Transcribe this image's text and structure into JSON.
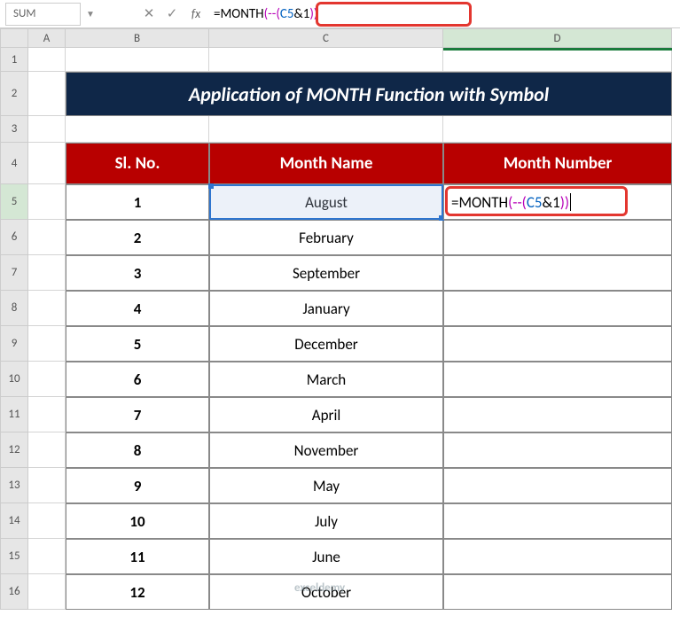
{
  "nameBox": "SUM",
  "formula": {
    "eq": "=",
    "fn": "MONTH",
    "op1": "(--(",
    "ref": "C5",
    "op2": "&",
    "num": "1",
    "op3": "))"
  },
  "colHeads": {
    "A": "A",
    "B": "B",
    "C": "C",
    "D": "D"
  },
  "rowHeads": [
    "1",
    "2",
    "3",
    "4",
    "5",
    "6",
    "7",
    "8",
    "9",
    "10",
    "11",
    "12",
    "13",
    "14",
    "15",
    "16"
  ],
  "title": "Application of MONTH Function with Symbol",
  "headers": {
    "sl": "Sl. No.",
    "month": "Month Name",
    "num": "Month Number"
  },
  "rows": [
    {
      "n": "1",
      "m": "August"
    },
    {
      "n": "2",
      "m": "February"
    },
    {
      "n": "3",
      "m": "September"
    },
    {
      "n": "4",
      "m": "January"
    },
    {
      "n": "5",
      "m": "December"
    },
    {
      "n": "6",
      "m": "March"
    },
    {
      "n": "7",
      "m": "April"
    },
    {
      "n": "8",
      "m": "November"
    },
    {
      "n": "9",
      "m": "May"
    },
    {
      "n": "10",
      "m": "July"
    },
    {
      "n": "11",
      "m": "June"
    },
    {
      "n": "12",
      "m": "October"
    }
  ],
  "watermark": "exceldemy"
}
